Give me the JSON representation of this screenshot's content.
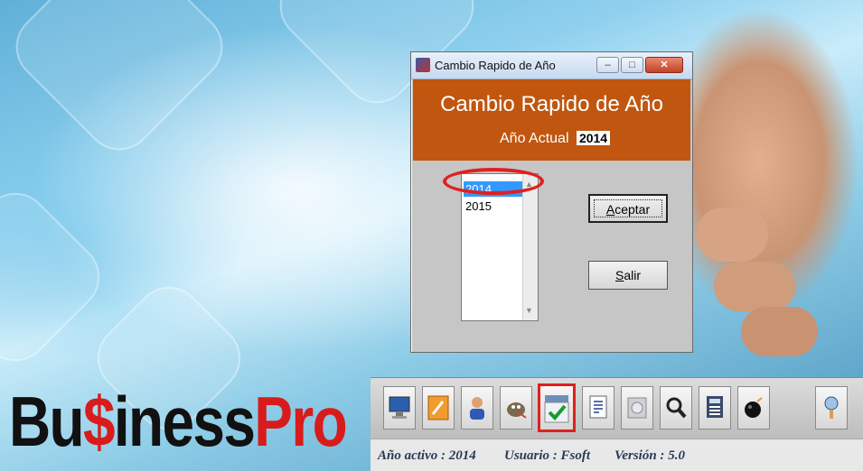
{
  "dialog": {
    "window_title": "Cambio Rapido de Año",
    "header_title": "Cambio Rapido de Año",
    "current_year_label": "Año Actual",
    "current_year_value": "2014",
    "year_list": [
      "2014",
      "2015"
    ],
    "selected_year": "2014",
    "accept_label": "Aceptar",
    "exit_label": "Salir",
    "min_glyph": "–",
    "max_glyph": "□",
    "close_glyph": "✕"
  },
  "logo": {
    "part1": "Bu",
    "dollar": "$",
    "part2": "iness",
    "part3": "Pro",
    "accent_color": "#d81c1c"
  },
  "toolbar": {
    "icons": [
      "monitor-icon",
      "tools-icon",
      "user-icon",
      "gimp-icon",
      "check-icon",
      "document-icon",
      "disk-icon",
      "search-icon",
      "calculator-icon",
      "bomb-icon",
      "help-icon"
    ],
    "selected_icon": "check-icon"
  },
  "status": {
    "year_label": "Año activo :",
    "year_value": "2014",
    "user_label": "Usuario :",
    "user_value": "Fsoft",
    "version_label": "Versión :",
    "version_value": "5.0"
  },
  "colors": {
    "header_band": "#c0560f",
    "highlight": "#e0201e",
    "selection": "#3399ff"
  }
}
